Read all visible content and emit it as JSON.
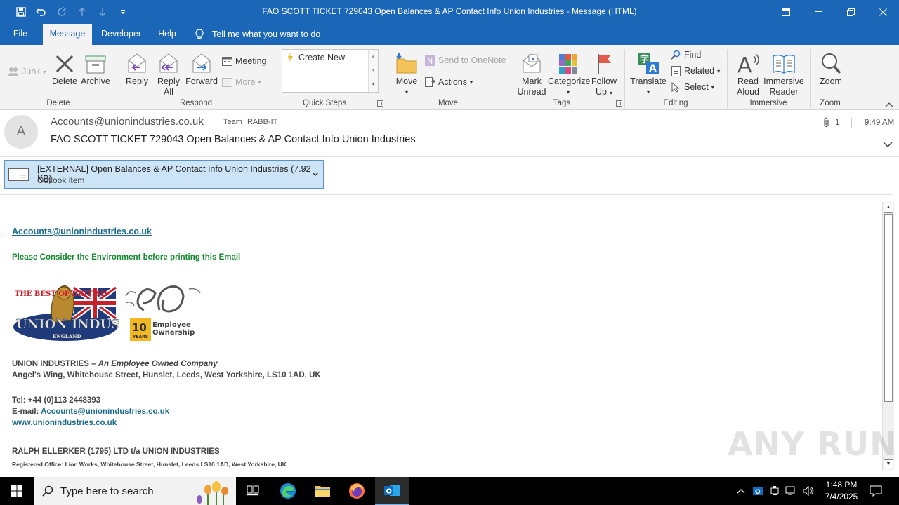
{
  "window": {
    "title": "FAO SCOTT TICKET 729043 Open Balances & AP Contact Info Union Industries  -  Message (HTML)"
  },
  "tabs": [
    "File",
    "Message",
    "Developer",
    "Help"
  ],
  "active_tab": "Message",
  "tell_me": "Tell me what you want to do",
  "ribbon": {
    "delete_group": {
      "label": "Delete",
      "junk": "Junk",
      "delete": "Delete",
      "archive": "Archive"
    },
    "respond_group": {
      "label": "Respond",
      "reply": "Reply",
      "reply_all_1": "Reply",
      "reply_all_2": "All",
      "forward": "Forward",
      "meeting": "Meeting",
      "more": "More"
    },
    "quick_steps_group": {
      "label": "Quick Steps",
      "create_new": "Create New"
    },
    "move_group": {
      "label": "Move",
      "move": "Move",
      "send_onenote": "Send to OneNote",
      "actions": "Actions"
    },
    "tags_group": {
      "label": "Tags",
      "mark_unread_1": "Mark",
      "mark_unread_2": "Unread",
      "categorize": "Categorize",
      "follow_up_1": "Follow",
      "follow_up_2": "Up"
    },
    "editing_group": {
      "label": "Editing",
      "translate": "Translate",
      "find": "Find",
      "related": "Related",
      "select": "Select"
    },
    "immersive_group": {
      "label": "Immersive",
      "read_aloud_1": "Read",
      "read_aloud_2": "Aloud",
      "immersive_reader_1": "Immersive",
      "immersive_reader_2": "Reader"
    },
    "zoom_group": {
      "label": "Zoom",
      "zoom": "Zoom"
    }
  },
  "message": {
    "avatar_letter": "A",
    "from": "Accounts@unionindustries.co.uk",
    "to_label": "Team",
    "to_value": "RABB-IT",
    "subject": "FAO SCOTT TICKET 729043 Open Balances & AP Contact Info Union Industries",
    "attachment_count": "1",
    "time": "9:49 AM"
  },
  "attachment": {
    "name": "[EXTERNAL] Open Balances & AP Contact Info Union Industries (7.92 KB)",
    "type": "Outlook item"
  },
  "body": {
    "email_link": "Accounts@unionindustries.co.uk",
    "environment_note": "Please Consider the Environment before printing this Email",
    "logo_text_1": "THE BEST OF BRITISH",
    "logo_text_2": "UNION INDUSTRIES",
    "logo_text_3": "ENGLAND",
    "eo_badge_number": "10",
    "eo_badge_years": "YEARS",
    "eo_text_1": "Employee",
    "eo_text_2": "Ownership",
    "company_name": "UNION INDUSTRIES – ",
    "company_tagline": "An Employee Owned Company",
    "address": "Angel's Wing, Whitehouse Street, Hunslet, Leeds, West Yorkshire, LS10 1AD, UK",
    "tel": "Tel: +44 (0)113 2448393",
    "email_label": "E-mail: ",
    "email_value": "Accounts@unionindustries.co.uk",
    "website": "www.unionindustries.co.uk",
    "legal_name": "RALPH ELLERKER (1795) LTD t/a UNION INDUSTRIES",
    "registered_office": "Registered Office:  Lion Works, Whitehouse Street, Hunslet, Leeds LS10 1AD, West Yorkshire, UK"
  },
  "watermark": "ANY RUN",
  "taskbar": {
    "search_placeholder": "Type here to search",
    "time": "1:48 PM",
    "date": "7/4/2025"
  },
  "colors": {
    "title_bar": "#1b66b7",
    "ribbon_bg": "#f3f3f3",
    "link": "#1f6b8f",
    "green_note": "#158a2e",
    "attachment_bg": "#cde4f7"
  }
}
